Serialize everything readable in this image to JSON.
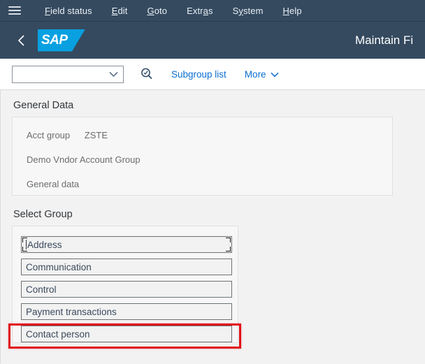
{
  "menubar": {
    "hamburger_icon": "hamburger-menu-icon",
    "items": [
      {
        "label": "Field status",
        "accel": "F"
      },
      {
        "label": "Edit",
        "accel": "E"
      },
      {
        "label": "Goto",
        "accel": "G"
      },
      {
        "label": "Extras",
        "accel": "a"
      },
      {
        "label": "System",
        "accel": "y"
      },
      {
        "label": "Help",
        "accel": "H"
      }
    ]
  },
  "shellbar": {
    "back_icon": "back-chevron-icon",
    "logo_text": "SAP",
    "title": "Maintain Fi"
  },
  "toolbar": {
    "combobox_value": "",
    "combobox_placeholder": "",
    "search_icon": "value-help-search-icon",
    "subgroup_list_label": "Subgroup list",
    "more_label": "More"
  },
  "general_data": {
    "section_title": "General Data",
    "rows": [
      {
        "label": "Acct group",
        "value": "ZSTE"
      },
      {
        "label": "Demo Vndor Account Group",
        "value": ""
      },
      {
        "label": "General data",
        "value": ""
      }
    ]
  },
  "select_group": {
    "section_title": "Select Group",
    "items": [
      {
        "label": "Address",
        "focused": true
      },
      {
        "label": "Communication",
        "focused": false
      },
      {
        "label": "Control",
        "focused": false
      },
      {
        "label": "Payment transactions",
        "focused": false
      },
      {
        "label": "Contact person",
        "focused": false
      }
    ]
  },
  "colors": {
    "shell_background": "#354a5f",
    "sap_logo_blue": "#08a0e1",
    "link_blue": "#0a6ed1",
    "annotation_red": "#e1121a",
    "page_background": "#f2f2f2"
  }
}
